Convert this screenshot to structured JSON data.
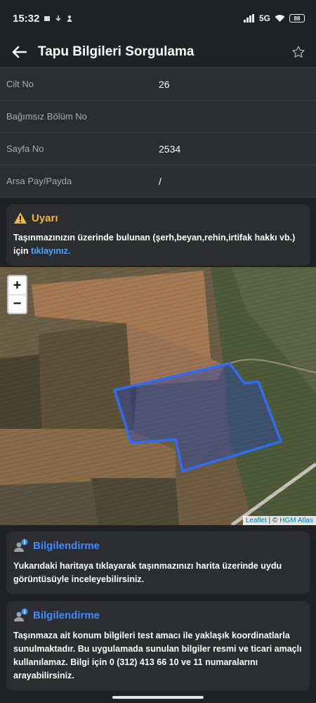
{
  "status": {
    "time": "15:32",
    "network": "5G",
    "battery": "88"
  },
  "appbar": {
    "title": "Tapu Bilgileri Sorgulama",
    "back_icon": "arrow-left-icon",
    "favorite_icon": "star-outline-icon"
  },
  "rows": [
    {
      "label": "Cilt No",
      "value": "26"
    },
    {
      "label": "Bağımsız Bölüm No",
      "value": ""
    },
    {
      "label": "Sayfa No",
      "value": "2534"
    },
    {
      "label": "Arsa Pay/Payda",
      "value": "/"
    }
  ],
  "warning": {
    "title": "Uyarı",
    "text": "Taşınmazınızın üzerinde bulunan (şerh,beyan,rehin,irtifak hakkı vb.) için",
    "link": "tıklayınız.",
    "color": "#f1b73a"
  },
  "map": {
    "zoom_in": "+",
    "zoom_out": "−",
    "attribution_leaflet": "Leaflet",
    "attribution_sep": " | © ",
    "attribution_source": "HGM Atlas",
    "parcel_color": "#2f6df2"
  },
  "info1": {
    "title": "Bilgilendirme",
    "text": "Yukarıdaki haritaya tıklayarak taşınmazınızı harita üzerinde uydu görüntüsüyle inceleyebilirsiniz."
  },
  "info2": {
    "title": "Bilgilendirme",
    "text": "Taşınmaza ait konum bilgileri test amacı ile yaklaşık koordinatlarla sunulmaktadır. Bu uygulamada sunulan bilgiler resmi ve ticari amaçlı kullanılamaz. Bilgi için 0 (312) 413 66 10 ve 11 numaralarını arayabilirsiniz."
  }
}
